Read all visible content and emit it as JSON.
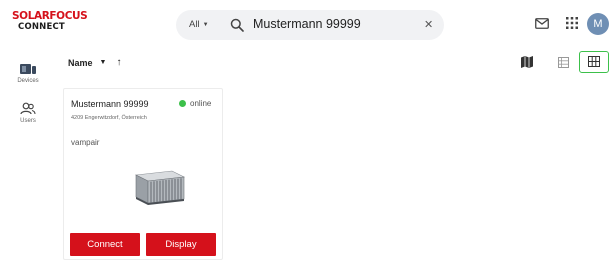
{
  "header": {
    "logo_top": "SOLARFOCUS",
    "logo_bottom": "CONNECT",
    "search": {
      "scope": "All",
      "value": "Mustermann 99999"
    },
    "avatar_initial": "M"
  },
  "sidebar": {
    "items": [
      {
        "label": "Devices",
        "icon": "devices-icon"
      },
      {
        "label": "Users",
        "icon": "users-icon"
      }
    ]
  },
  "toolbar": {
    "sort_field": "Name",
    "views": [
      "map-view-icon",
      "list-view-icon",
      "grid-view-icon"
    ],
    "active_view": "grid"
  },
  "devices": [
    {
      "name": "Mustermann 99999",
      "status": "online",
      "address": "4209 Engerwitzdorf, Österreich",
      "type": "vampair",
      "connect_label": "Connect",
      "display_label": "Display"
    }
  ],
  "colors": {
    "brand_red": "#d5111b",
    "online_green": "#3cc04a",
    "avatar": "#6f8fb4"
  }
}
